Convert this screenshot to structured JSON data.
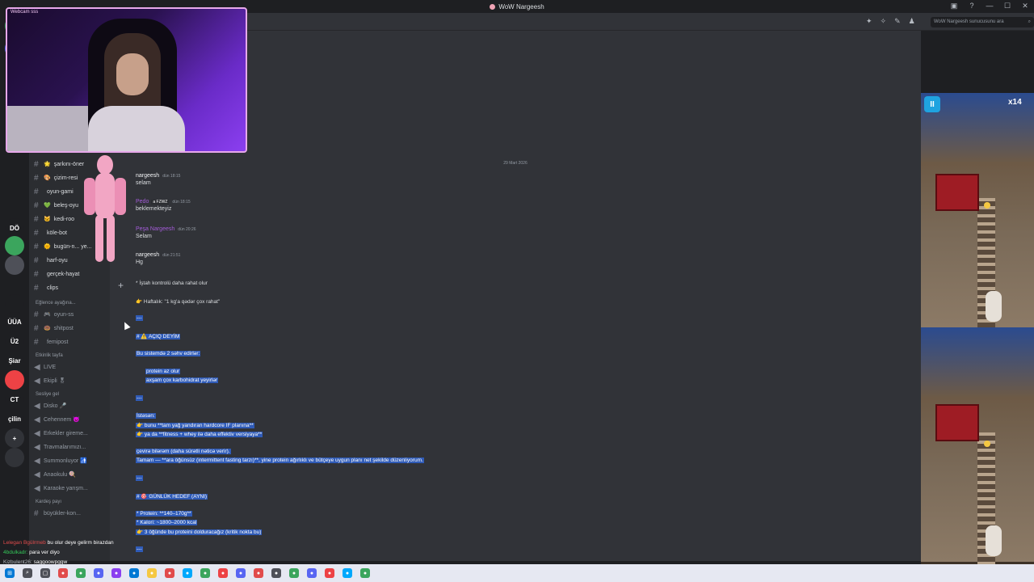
{
  "window": {
    "title": "WoW Nargeesh",
    "controls": [
      "▣",
      "?",
      "—",
      "☐",
      "✕"
    ]
  },
  "webcam": {
    "label": "Webcam sss"
  },
  "servers": [
    {
      "label": "",
      "color": "#3ba55d"
    },
    {
      "label": "",
      "color": "#5865f2"
    },
    {
      "label": "DÖ",
      "color": "#1e1f22"
    },
    {
      "label": "",
      "color": "#3ba55d"
    },
    {
      "label": "",
      "color": "#4e5058"
    },
    {
      "label": "",
      "color": "#1e1f22"
    },
    {
      "label": "ÜÜA",
      "color": "#1e1f22"
    },
    {
      "label": "Ü2",
      "color": "#1e1f22"
    },
    {
      "label": "Şiar",
      "color": "#1e1f22"
    },
    {
      "label": "",
      "color": "#ed4245"
    },
    {
      "label": "CT",
      "color": "#1e1f22"
    },
    {
      "label": "çilin",
      "color": "#1e1f22"
    },
    {
      "label": "+",
      "color": "#313338"
    },
    {
      "label": "",
      "color": "#313338"
    }
  ],
  "channels": {
    "text": [
      {
        "icon": "🌟",
        "name": "şarkını-öner"
      },
      {
        "icon": "🎨",
        "name": "çizim-resi"
      },
      {
        "icon": "",
        "name": "oyun-gami"
      },
      {
        "icon": "💚",
        "name": "beleş-oyu"
      },
      {
        "icon": "🐱",
        "name": "kedi-roo"
      },
      {
        "icon": "",
        "name": "köle-bot"
      },
      {
        "icon": "🌞",
        "name": "bugün-n... ye..."
      },
      {
        "icon": "",
        "name": "harf-oyu"
      },
      {
        "icon": "",
        "name": "gerçek-hayat"
      },
      {
        "icon": "",
        "name": "clips"
      }
    ],
    "category_fun": "Eğlence ayağına...",
    "fun": [
      {
        "icon": "🎮",
        "name": "oyun-ss"
      },
      {
        "icon": "🍩",
        "name": "shitpost"
      },
      {
        "icon": "",
        "name": "femipost"
      }
    ],
    "category_events": "Etkinlik tayfa",
    "events": [
      {
        "name": "LIVE"
      },
      {
        "name": "Ekipli 🎖"
      }
    ],
    "category_voice": "Sesliye gel",
    "voice": [
      {
        "name": "Disko 🎤"
      },
      {
        "name": "Cehennem 👿"
      },
      {
        "name": "Erkekler gireme..."
      },
      {
        "name": "Travmalarımızı..."
      },
      {
        "name": "Summonluyor 🚮"
      },
      {
        "name": "Anaokulu 🍭"
      },
      {
        "name": "Karaoke yarışm..."
      }
    ],
    "category_sibs": "Kardeş payı",
    "sibs": [
      {
        "name": "büyükler-kon..."
      }
    ]
  },
  "topbar": {
    "search_placeholder": "WoW Nargeesh sunucusunu ara",
    "search_icon": "⌕"
  },
  "messages": {
    "date_divider": "29 Mart 2026",
    "list": [
      {
        "author": "nargeesh",
        "tag": "",
        "time": "dün 18:15",
        "text": "selam"
      },
      {
        "author": "Pedo",
        "tag": "a FZWZ",
        "time": "dün 18:15",
        "text": "beklemekteyiz"
      },
      {
        "author": "Peşa Nargeesh",
        "tag": "",
        "time": "dün 20:26",
        "text": "Selam"
      },
      {
        "author": "nargeesh",
        "tag": "",
        "time": "dün 21:51",
        "text": "Hg"
      }
    ]
  },
  "composer": {
    "lines": [
      {
        "text": "* İştah kontrolü daha rahat olur",
        "sel": false
      },
      {
        "text": "👉 Haftalık: \"1 kg'a qədər çox rahat\"",
        "sel": false
      },
      {
        "text": "---",
        "sel": true
      },
      {
        "text": "# ⚠️ AÇIQ DEYİM",
        "sel": true
      },
      {
        "text": "Bu sistemdə 2 səhv edirlər:",
        "sel": true
      },
      {
        "text": "protein az olur",
        "sel": true,
        "indent": true
      },
      {
        "text": "axşam çox karbohidrat yeyirlər",
        "sel": true,
        "indent": true
      },
      {
        "text": "---",
        "sel": true
      },
      {
        "text": "İstəsən:",
        "sel": true
      },
      {
        "text": "👉 bunu **tam yağ yandıran hardcore IF planına**",
        "sel": true
      },
      {
        "text": "👉 ya da **fitness + whey ilə daha effektiv versiyaya**",
        "sel": true
      },
      {
        "text": "çevirə bilərəm (daha sürətli nəticə verir).",
        "sel": true
      },
      {
        "text": "Tamam — **ara öğünsüz (intermittent fasting tarzı)**, yine protein ağırlıklı ve bütçeye uygun planı net şekilde düzenliyorum.",
        "sel": true
      },
      {
        "text": "---",
        "sel": true
      },
      {
        "text": "# 🎯 GÜNLÜK HEDEF (AYNI)",
        "sel": true
      },
      {
        "text": "* Protein: **140–170g**",
        "sel": true
      },
      {
        "text": "* Kalori: ~1800–2000 kcal",
        "sel": true
      },
      {
        "text": "👉 3 öğünde bu proteini dolduracağız (kritik nokta bu)",
        "sel": true
      },
      {
        "text": "---",
        "sel": true
      }
    ]
  },
  "game": {
    "multiplier": "x14",
    "pause_label": "II"
  },
  "stream_chat": [
    {
      "name": "Lelegan Bgülrmeb",
      "name_class": "name-red",
      "text": "bu olur deye gelirm birazdan"
    },
    {
      "name": "4bdulkadr:",
      "name_class": "name-green",
      "text": "para ver diyo"
    },
    {
      "name": "Kizbulent26:",
      "name_class": "name-gray",
      "text": "saggoowpggw"
    }
  ],
  "taskbar": {
    "icons": [
      {
        "name": "start-icon",
        "glyph": "⊞",
        "color": "#0078d4"
      },
      {
        "name": "search-icon",
        "glyph": "⌕",
        "color": "#4e5058"
      },
      {
        "name": "taskview-icon",
        "glyph": "▢",
        "color": "#4e5058"
      },
      {
        "name": "app-icon",
        "glyph": "●",
        "color": "#e14b4b"
      },
      {
        "name": "app-icon",
        "glyph": "●",
        "color": "#3ba55d"
      },
      {
        "name": "app-icon",
        "glyph": "●",
        "color": "#5865f2"
      },
      {
        "name": "app-icon",
        "glyph": "●",
        "color": "#8b3ff0"
      },
      {
        "name": "app-icon",
        "glyph": "●",
        "color": "#0078d4"
      },
      {
        "name": "app-icon",
        "glyph": "●",
        "color": "#f5c842"
      },
      {
        "name": "app-icon",
        "glyph": "●",
        "color": "#e14b4b"
      },
      {
        "name": "app-icon",
        "glyph": "●",
        "color": "#00a8fc"
      },
      {
        "name": "app-icon",
        "glyph": "●",
        "color": "#3ba55d"
      },
      {
        "name": "app-icon",
        "glyph": "●",
        "color": "#ed4245"
      },
      {
        "name": "app-icon",
        "glyph": "●",
        "color": "#5865f2"
      },
      {
        "name": "app-icon",
        "glyph": "●",
        "color": "#e14b4b"
      },
      {
        "name": "app-icon",
        "glyph": "●",
        "color": "#4e5058"
      },
      {
        "name": "app-icon",
        "glyph": "●",
        "color": "#3ba55d"
      },
      {
        "name": "app-icon",
        "glyph": "●",
        "color": "#5865f2"
      },
      {
        "name": "app-icon",
        "glyph": "●",
        "color": "#ed4245"
      },
      {
        "name": "app-icon",
        "glyph": "●",
        "color": "#00a8fc"
      },
      {
        "name": "app-icon",
        "glyph": "●",
        "color": "#3ba55d"
      }
    ]
  }
}
